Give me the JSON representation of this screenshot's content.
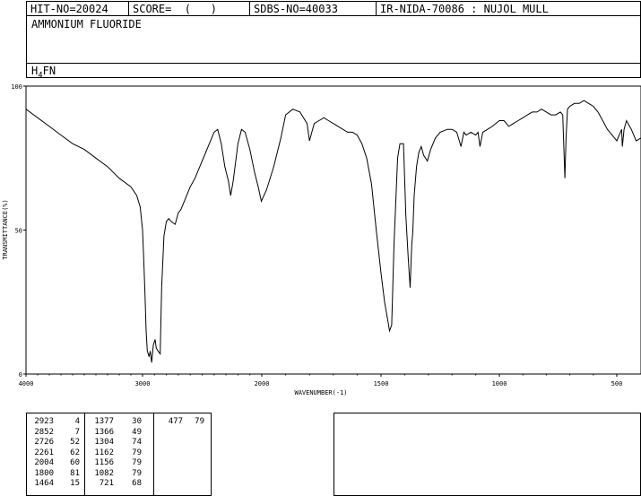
{
  "header": {
    "hit_no": "HIT-NO=20024",
    "score": "SCORE=  (   )",
    "sdbs_no": "SDBS-NO=40033",
    "ir_nida": "IR-NIDA-70086 : NUJOL MULL"
  },
  "compound": {
    "name": "AMMONIUM FLUORIDE",
    "formula_prefix": "H",
    "formula_sub": "4",
    "formula_suffix": "FN"
  },
  "chart_data": {
    "type": "line",
    "xlabel": "WAVENUMBER(-1)",
    "ylabel": "TRANSMITTANCE(%)",
    "xlim": [
      4000,
      400
    ],
    "ylim": [
      0,
      100
    ],
    "x_ticks": [
      4000,
      3000,
      2000,
      1500,
      1000,
      500
    ],
    "y_ticks": [
      0,
      50,
      100
    ],
    "series": [
      {
        "points": [
          [
            4000,
            92
          ],
          [
            3900,
            89
          ],
          [
            3800,
            86
          ],
          [
            3700,
            83
          ],
          [
            3600,
            80
          ],
          [
            3500,
            78
          ],
          [
            3400,
            75
          ],
          [
            3300,
            72
          ],
          [
            3200,
            68
          ],
          [
            3100,
            65
          ],
          [
            3050,
            62
          ],
          [
            3020,
            58
          ],
          [
            3000,
            50
          ],
          [
            2990,
            40
          ],
          [
            2980,
            28
          ],
          [
            2970,
            15
          ],
          [
            2960,
            8
          ],
          [
            2945,
            6
          ],
          [
            2935,
            8
          ],
          [
            2923,
            4
          ],
          [
            2910,
            10
          ],
          [
            2895,
            12
          ],
          [
            2885,
            9
          ],
          [
            2870,
            8
          ],
          [
            2852,
            7
          ],
          [
            2840,
            30
          ],
          [
            2820,
            48
          ],
          [
            2800,
            53
          ],
          [
            2780,
            54
          ],
          [
            2760,
            53
          ],
          [
            2726,
            52
          ],
          [
            2700,
            56
          ],
          [
            2680,
            57
          ],
          [
            2650,
            60
          ],
          [
            2620,
            63
          ],
          [
            2600,
            65
          ],
          [
            2560,
            68
          ],
          [
            2520,
            72
          ],
          [
            2480,
            76
          ],
          [
            2440,
            80
          ],
          [
            2400,
            84
          ],
          [
            2370,
            85
          ],
          [
            2340,
            80
          ],
          [
            2310,
            72
          ],
          [
            2280,
            67
          ],
          [
            2261,
            62
          ],
          [
            2240,
            67
          ],
          [
            2200,
            80
          ],
          [
            2170,
            85
          ],
          [
            2140,
            84
          ],
          [
            2100,
            78
          ],
          [
            2060,
            70
          ],
          [
            2030,
            65
          ],
          [
            2004,
            60
          ],
          [
            1980,
            64
          ],
          [
            1950,
            72
          ],
          [
            1920,
            82
          ],
          [
            1900,
            90
          ],
          [
            1870,
            92
          ],
          [
            1840,
            91
          ],
          [
            1810,
            87
          ],
          [
            1800,
            81
          ],
          [
            1780,
            87
          ],
          [
            1760,
            88
          ],
          [
            1740,
            89
          ],
          [
            1720,
            88
          ],
          [
            1700,
            87
          ],
          [
            1680,
            86
          ],
          [
            1660,
            85
          ],
          [
            1640,
            84
          ],
          [
            1620,
            84
          ],
          [
            1600,
            83
          ],
          [
            1580,
            80
          ],
          [
            1560,
            75
          ],
          [
            1540,
            66
          ],
          [
            1520,
            50
          ],
          [
            1500,
            35
          ],
          [
            1485,
            25
          ],
          [
            1470,
            18
          ],
          [
            1464,
            15
          ],
          [
            1455,
            17
          ],
          [
            1445,
            45
          ],
          [
            1430,
            75
          ],
          [
            1420,
            80
          ],
          [
            1405,
            80
          ],
          [
            1395,
            55
          ],
          [
            1385,
            40
          ],
          [
            1377,
            30
          ],
          [
            1370,
            45
          ],
          [
            1366,
            49
          ],
          [
            1360,
            62
          ],
          [
            1350,
            72
          ],
          [
            1340,
            77
          ],
          [
            1330,
            79
          ],
          [
            1320,
            76
          ],
          [
            1304,
            74
          ],
          [
            1290,
            78
          ],
          [
            1270,
            82
          ],
          [
            1250,
            84
          ],
          [
            1220,
            85
          ],
          [
            1200,
            85
          ],
          [
            1180,
            84
          ],
          [
            1162,
            79
          ],
          [
            1150,
            84
          ],
          [
            1140,
            83
          ],
          [
            1120,
            84
          ],
          [
            1100,
            83
          ],
          [
            1090,
            84
          ],
          [
            1082,
            79
          ],
          [
            1070,
            84
          ],
          [
            1050,
            85
          ],
          [
            1030,
            86
          ],
          [
            1000,
            88
          ],
          [
            980,
            88
          ],
          [
            960,
            86
          ],
          [
            940,
            87
          ],
          [
            920,
            88
          ],
          [
            900,
            89
          ],
          [
            880,
            90
          ],
          [
            860,
            91
          ],
          [
            840,
            91
          ],
          [
            820,
            92
          ],
          [
            800,
            91
          ],
          [
            780,
            90
          ],
          [
            760,
            90
          ],
          [
            740,
            91
          ],
          [
            730,
            90
          ],
          [
            726,
            80
          ],
          [
            721,
            68
          ],
          [
            716,
            82
          ],
          [
            710,
            92
          ],
          [
            700,
            93
          ],
          [
            680,
            94
          ],
          [
            660,
            94
          ],
          [
            640,
            95
          ],
          [
            620,
            94
          ],
          [
            600,
            93
          ],
          [
            580,
            91
          ],
          [
            560,
            88
          ],
          [
            540,
            85
          ],
          [
            520,
            83
          ],
          [
            510,
            82
          ],
          [
            500,
            81
          ],
          [
            490,
            83
          ],
          [
            480,
            85
          ],
          [
            477,
            79
          ],
          [
            470,
            85
          ],
          [
            460,
            88
          ],
          [
            440,
            85
          ],
          [
            420,
            81
          ],
          [
            400,
            82
          ]
        ]
      }
    ]
  },
  "peak_table": [
    [
      "2923",
      "4",
      "1377",
      "30",
      "477",
      "79"
    ],
    [
      "2852",
      "7",
      "1366",
      "49",
      "",
      ""
    ],
    [
      "2726",
      "52",
      "1304",
      "74",
      "",
      ""
    ],
    [
      "2261",
      "62",
      "1162",
      "79",
      "",
      ""
    ],
    [
      "2004",
      "60",
      "1156",
      "79",
      "",
      ""
    ],
    [
      "1800",
      "81",
      "1082",
      "79",
      "",
      ""
    ],
    [
      "1464",
      "15",
      "721",
      "68",
      "",
      ""
    ]
  ]
}
